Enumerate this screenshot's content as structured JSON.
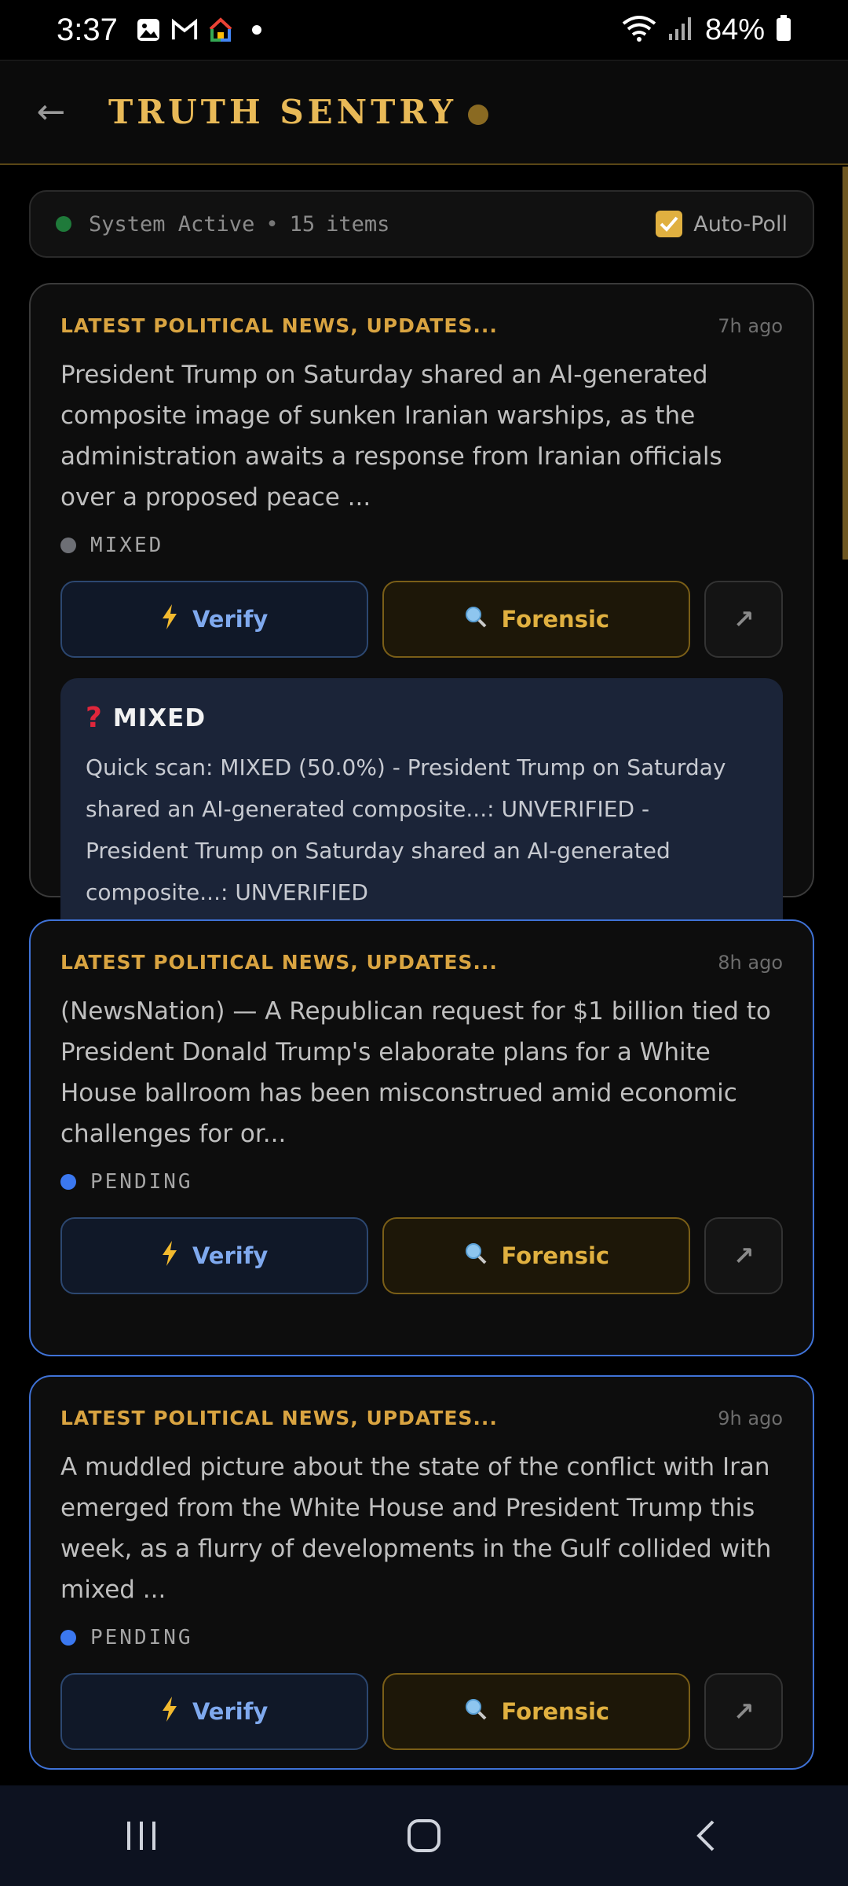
{
  "status_bar": {
    "time": "3:37",
    "battery": "84%"
  },
  "header": {
    "back_icon": "arrow-left-icon",
    "title": "TRUTH SENTRY"
  },
  "system_strip": {
    "status": "System Active",
    "separator": "•",
    "count": "15",
    "count_label": "items",
    "autopoll_label": "Auto-Poll",
    "autopoll_checked": true
  },
  "buttons": {
    "verify_label": "Verify",
    "forensic_label": "Forensic"
  },
  "colors": {
    "accent_gold": "#e0b040",
    "verify_blue": "#7fa9ee",
    "pending_blue": "#3b78f0",
    "mixed_gray": "#6d6f75"
  },
  "articles": [
    {
      "source": "LATEST POLITICAL NEWS, UPDATES...",
      "time_ago": "7h ago",
      "text": "President Trump on Saturday shared an AI-generated composite image of sunken Iranian warships, as the administration awaits a response from Iranian officials over a proposed peace ...",
      "status": "MIXED",
      "verdict": {
        "icon": "question-mark-icon",
        "title": "MIXED",
        "text": "Quick scan: MIXED (50.0%) - President Trump on Saturday shared an AI-generated composite...: UNVERIFIED - President Trump on Saturday shared an AI-generated composite...: UNVERIFIED"
      }
    },
    {
      "source": "LATEST POLITICAL NEWS, UPDATES...",
      "time_ago": "8h ago",
      "text": "(NewsNation) — A Republican request for $1 billion tied to President Donald Trump's elaborate plans for a White House ballroom has been misconstrued amid economic challenges for or...",
      "status": "PENDING"
    },
    {
      "source": "LATEST POLITICAL NEWS, UPDATES...",
      "time_ago": "9h ago",
      "text": "A muddled picture about the state of the conflict with Iran emerged from the White House and President Trump this week, as a flurry of developments in the Gulf collided with mixed ...",
      "status": "PENDING"
    }
  ]
}
